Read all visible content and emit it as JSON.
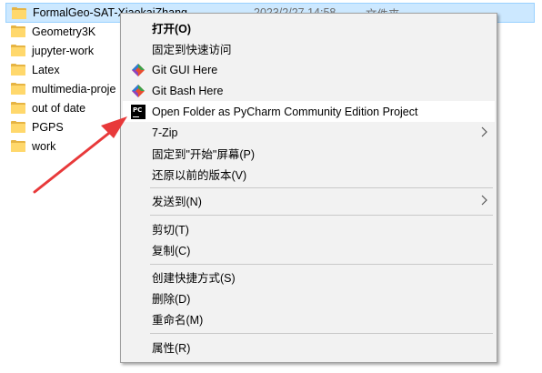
{
  "files": [
    {
      "name": "FormalGeo-SAT-XiaokaiZhang",
      "date": "2023/2/27 14:58",
      "type": "文件夹",
      "selected": true
    },
    {
      "name": "Geometry3K"
    },
    {
      "name": "jupyter-work"
    },
    {
      "name": "Latex"
    },
    {
      "name": "multimedia-proje"
    },
    {
      "name": "out of date"
    },
    {
      "name": "PGPS"
    },
    {
      "name": "work"
    }
  ],
  "context_menu": {
    "items": {
      "open": "打开(O)",
      "pin_quick_access": "固定到快速访问",
      "git_gui": "Git GUI Here",
      "git_bash": "Git Bash Here",
      "pycharm": "Open Folder as PyCharm Community Edition Project",
      "seven_zip": "7-Zip",
      "pin_start": "固定到\"开始\"屏幕(P)",
      "restore_versions": "还原以前的版本(V)",
      "send_to": "发送到(N)",
      "cut": "剪切(T)",
      "copy": "复制(C)",
      "create_shortcut": "创建快捷方式(S)",
      "delete": "删除(D)",
      "rename": "重命名(M)",
      "properties": "属性(R)"
    },
    "icons": {
      "git": "git-icon",
      "pycharm": "pycharm-icon",
      "submenu": "chevron-right-icon"
    },
    "pycharm_icon_text": "PC"
  },
  "annotation": {
    "color": "#e8393a",
    "icon": "red-arrow"
  }
}
